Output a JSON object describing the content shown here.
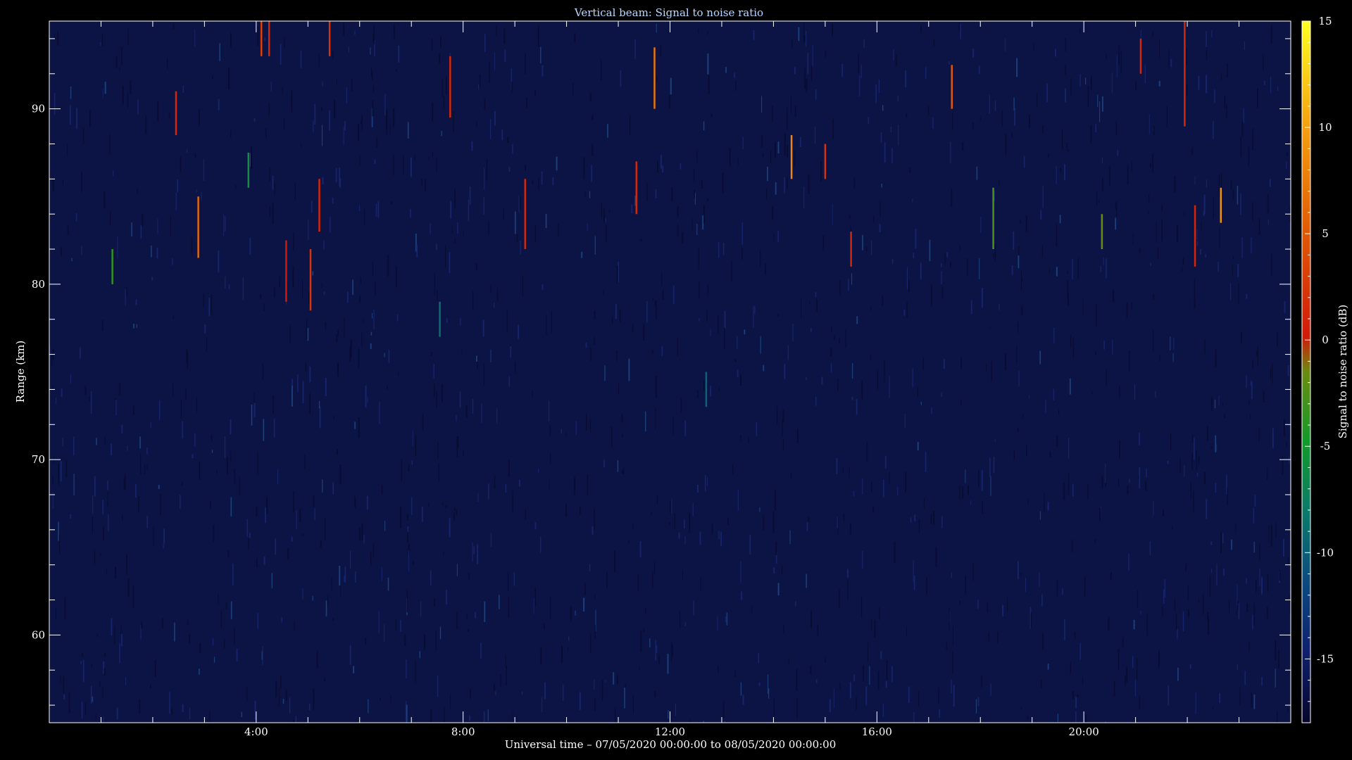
{
  "chart_data": {
    "type": "heatmap",
    "title": "Vertical beam: Signal to noise ratio",
    "xlabel": "Universal time – 07/05/2020 00:00:00 to 08/05/2020 00:00:00",
    "ylabel": "Range (km)",
    "colorbar_label": "Signal to noise ratio (dB)",
    "xlim": [
      0,
      24
    ],
    "ylim": [
      55,
      95
    ],
    "x_ticks": [
      "4:00",
      "8:00",
      "12:00",
      "16:00",
      "20:00"
    ],
    "x_tick_hours": [
      4,
      8,
      12,
      16,
      20
    ],
    "y_ticks": [
      60,
      70,
      80,
      90
    ],
    "colorbar_ticks": [
      15,
      10,
      5,
      0,
      -5,
      -10,
      -15
    ],
    "colorbar_range": [
      -18,
      15
    ],
    "background_db": -18,
    "colors": {
      "background": "#000000",
      "plot_background": "#0c1446",
      "axis": "#ffffff",
      "title": "#b8d8ff"
    },
    "echoes": [
      {
        "t": 1.22,
        "r0": 80.0,
        "r1": 82.0,
        "snr": -4
      },
      {
        "t": 2.45,
        "r0": 88.5,
        "r1": 91.0,
        "snr": 1
      },
      {
        "t": 2.88,
        "r0": 81.5,
        "r1": 85.0,
        "snr": 6
      },
      {
        "t": 3.85,
        "r0": 85.5,
        "r1": 87.5,
        "snr": -6
      },
      {
        "t": 4.1,
        "r0": 93.0,
        "r1": 95.0,
        "snr": 3
      },
      {
        "t": 4.25,
        "r0": 93.0,
        "r1": 95.0,
        "snr": 1
      },
      {
        "t": 4.58,
        "r0": 79.0,
        "r1": 82.5,
        "snr": 0
      },
      {
        "t": 5.05,
        "r0": 78.5,
        "r1": 82.0,
        "snr": 2
      },
      {
        "t": 5.22,
        "r0": 83.0,
        "r1": 86.0,
        "snr": 1
      },
      {
        "t": 5.42,
        "r0": 93.0,
        "r1": 95.0,
        "snr": 2
      },
      {
        "t": 7.75,
        "r0": 89.5,
        "r1": 93.0,
        "snr": 1
      },
      {
        "t": 7.55,
        "r0": 77.0,
        "r1": 79.0,
        "snr": -9
      },
      {
        "t": 9.2,
        "r0": 82.0,
        "r1": 86.0,
        "snr": 1
      },
      {
        "t": 11.35,
        "r0": 84.0,
        "r1": 87.0,
        "snr": 1
      },
      {
        "t": 11.7,
        "r0": 90.0,
        "r1": 93.5,
        "snr": 7
      },
      {
        "t": 12.7,
        "r0": 73.0,
        "r1": 75.0,
        "snr": -10
      },
      {
        "t": 14.35,
        "r0": 86.0,
        "r1": 88.5,
        "snr": 8
      },
      {
        "t": 15.0,
        "r0": 86.0,
        "r1": 88.0,
        "snr": 2
      },
      {
        "t": 15.5,
        "r0": 81.0,
        "r1": 83.0,
        "snr": 1
      },
      {
        "t": 17.45,
        "r0": 90.0,
        "r1": 92.5,
        "snr": 5
      },
      {
        "t": 18.25,
        "r0": 82.0,
        "r1": 85.5,
        "snr": -3
      },
      {
        "t": 20.35,
        "r0": 82.0,
        "r1": 84.0,
        "snr": -2
      },
      {
        "t": 21.1,
        "r0": 92.0,
        "r1": 94.0,
        "snr": 1
      },
      {
        "t": 21.95,
        "r0": 89.0,
        "r1": 95.0,
        "snr": 1
      },
      {
        "t": 22.15,
        "r0": 81.0,
        "r1": 84.5,
        "snr": 1
      },
      {
        "t": 22.65,
        "r0": 83.5,
        "r1": 85.5,
        "snr": 9
      }
    ]
  }
}
